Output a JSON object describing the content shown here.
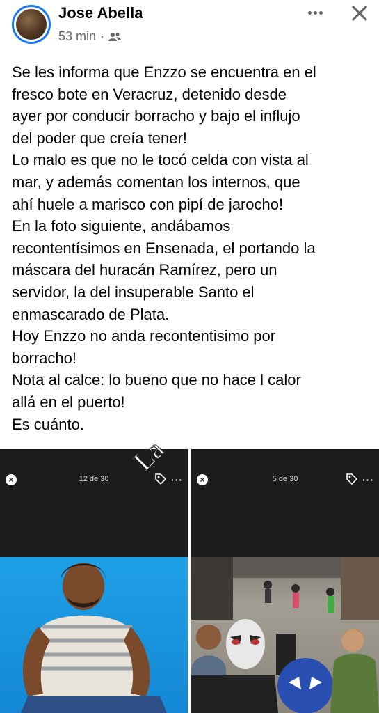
{
  "post": {
    "author": "Jose Abella",
    "time": "53 min",
    "separator": "·",
    "audience_icon": "friends-icon",
    "text_lines": [
      "Se les informa que Enzzo se encuentra en el",
      "fresco bote en Veracruz, detenido desde",
      "ayer por conducir borracho y bajo el influjo",
      "del poder que creía tener!",
      "Lo malo es que no le tocó celda con vista al",
      "mar, y además comentan los internos, que",
      "ahí huele a marisco con pipí de jarocho!",
      "En la foto siguiente, andábamos",
      "recontentísimos en Ensenada, el portando la",
      "máscara del huracán Ramírez, pero un",
      "servidor, la del insuperable Santo el",
      "enmascarado de Plata.",
      "Hoy Enzzo no anda recontentisimo por",
      "borracho!",
      "Nota al calce: lo bueno que no hace l calor",
      "allá en el puerto!",
      "Es cuánto."
    ]
  },
  "photos": [
    {
      "counter": "12 de 30",
      "menu": "···"
    },
    {
      "counter": "5 de 30",
      "menu": "···"
    }
  ],
  "watermark": "La",
  "colors": {
    "accent": "#1877f2",
    "meta": "#65676b",
    "text": "#050505"
  }
}
